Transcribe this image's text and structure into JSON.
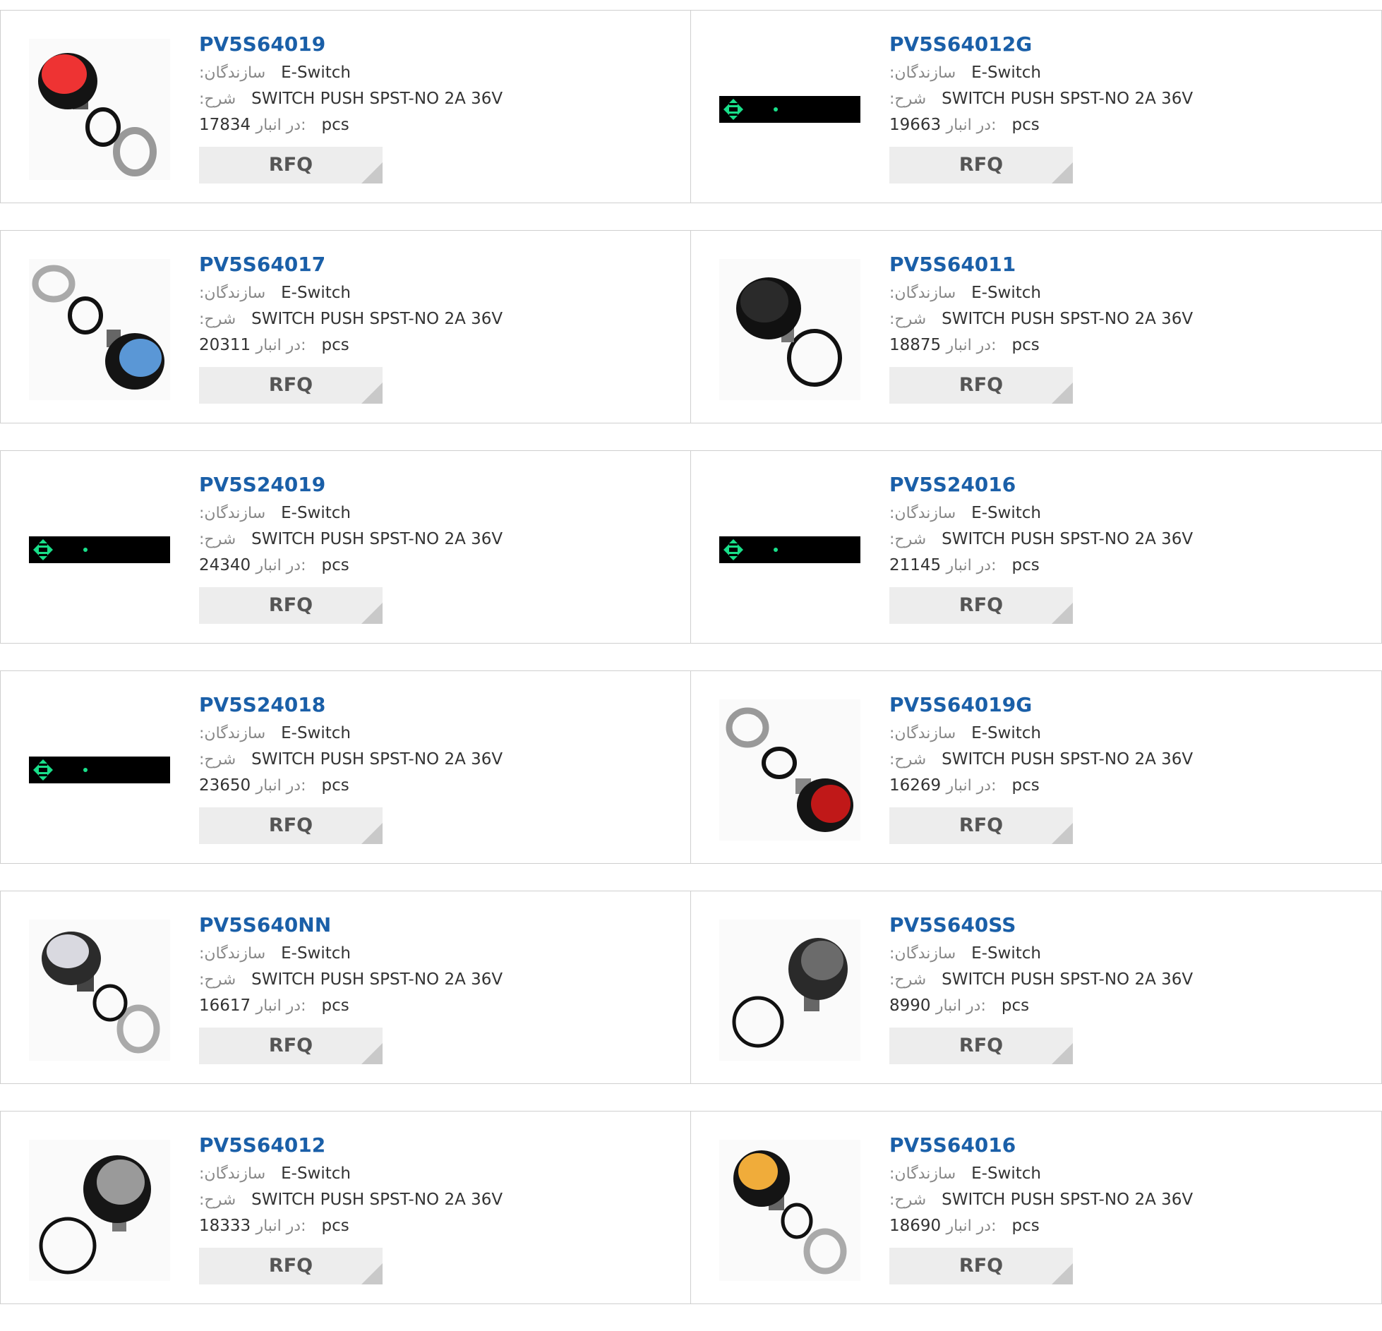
{
  "labels": {
    "manufacturer": ":سازندگان",
    "description": ":شرح",
    "stock": "در انبار:",
    "unit": "pcs",
    "rfq": "RFQ"
  },
  "products": [
    {
      "part": "PV5S64019",
      "manufacturer": "E-Switch",
      "description": "SWITCH PUSH SPST-NO 2A 36V",
      "stock": "17834",
      "image": "red-button"
    },
    {
      "part": "PV5S64012G",
      "manufacturer": "E-Switch",
      "description": "SWITCH PUSH SPST-NO 2A 36V",
      "stock": "19663",
      "image": "placeholder"
    },
    {
      "part": "PV5S64017",
      "manufacturer": "E-Switch",
      "description": "SWITCH PUSH SPST-NO 2A 36V",
      "stock": "20311",
      "image": "blue-button"
    },
    {
      "part": "PV5S64011",
      "manufacturer": "E-Switch",
      "description": "SWITCH PUSH SPST-NO 2A 36V",
      "stock": "18875",
      "image": "black-button"
    },
    {
      "part": "PV5S24019",
      "manufacturer": "E-Switch",
      "description": "SWITCH PUSH SPST-NO 2A 36V",
      "stock": "24340",
      "image": "placeholder"
    },
    {
      "part": "PV5S24016",
      "manufacturer": "E-Switch",
      "description": "SWITCH PUSH SPST-NO 2A 36V",
      "stock": "21145",
      "image": "placeholder"
    },
    {
      "part": "PV5S24018",
      "manufacturer": "E-Switch",
      "description": "SWITCH PUSH SPST-NO 2A 36V",
      "stock": "23650",
      "image": "placeholder"
    },
    {
      "part": "PV5S64019G",
      "manufacturer": "E-Switch",
      "description": "SWITCH PUSH SPST-NO 2A 36V",
      "stock": "16269",
      "image": "red-button-angled"
    },
    {
      "part": "PV5S640NN",
      "manufacturer": "E-Switch",
      "description": "SWITCH PUSH SPST-NO 2A 36V",
      "stock": "16617",
      "image": "silver-button"
    },
    {
      "part": "PV5S640SS",
      "manufacturer": "E-Switch",
      "description": "SWITCH PUSH SPST-NO 2A 36V",
      "stock": "8990",
      "image": "steel-button"
    },
    {
      "part": "PV5S64012",
      "manufacturer": "E-Switch",
      "description": "SWITCH PUSH SPST-NO 2A 36V",
      "stock": "18333",
      "image": "white-button"
    },
    {
      "part": "PV5S64016",
      "manufacturer": "E-Switch",
      "description": "SWITCH PUSH SPST-NO 2A 36V",
      "stock": "18690",
      "image": "yellow-button"
    }
  ],
  "colors": {
    "title": "#1a5fa8",
    "rfq_bg": "#ededed",
    "border": "#cfcfcf",
    "placeholder_icon": "#19e08a"
  }
}
